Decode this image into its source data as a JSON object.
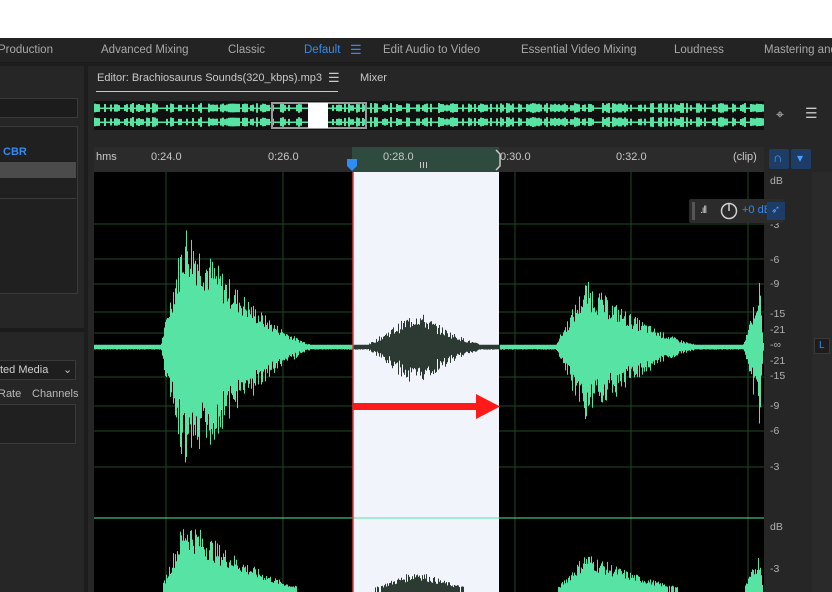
{
  "workspaces": [
    {
      "label": "Production",
      "active": false
    },
    {
      "label": "Advanced Mixing",
      "active": false
    },
    {
      "label": "Classic",
      "active": false
    },
    {
      "label": "Default",
      "active": true
    },
    {
      "label": "Edit Audio to Video",
      "active": false
    },
    {
      "label": "Essential Video Mixing",
      "active": false
    },
    {
      "label": "Loudness",
      "active": false
    },
    {
      "label": "Mastering and",
      "active": false
    }
  ],
  "workspace_menu_icon": "hamburger-icon",
  "left_panel": {
    "format_text": "CBR",
    "media_dropdown_value": "ted Media",
    "col_rate": "Rate",
    "col_channels": "Channels"
  },
  "editor": {
    "tab_editor": "Editor: Brachiosaurus Sounds(320_kbps).mp3",
    "tab_menu_icon": "hamburger-icon",
    "tab_mixer": "Mixer"
  },
  "ruler": {
    "unit": "hms",
    "ticks": [
      "0:24.0",
      "0:26.0",
      "0:28.0",
      "0:30.0",
      "0:32.0"
    ],
    "clip_label": "(clip)"
  },
  "db_scale_top": [
    "dB",
    "-3",
    "-6",
    "-9",
    "-15",
    "-21",
    "-∞",
    "-21",
    "-15",
    "-9",
    "-6",
    "-3"
  ],
  "db_scale_bottom": [
    "dB",
    "-3"
  ],
  "channel_label": "L",
  "volume_hud": {
    "value": "+0 dB"
  },
  "colors": {
    "waveform": "#56e3a3",
    "waveform_selected": "#2d3a33",
    "selection": "#f2f4fb",
    "accent": "#2f8cf5",
    "arrow": "#ff1a1a",
    "playhead": "#e8393a"
  }
}
